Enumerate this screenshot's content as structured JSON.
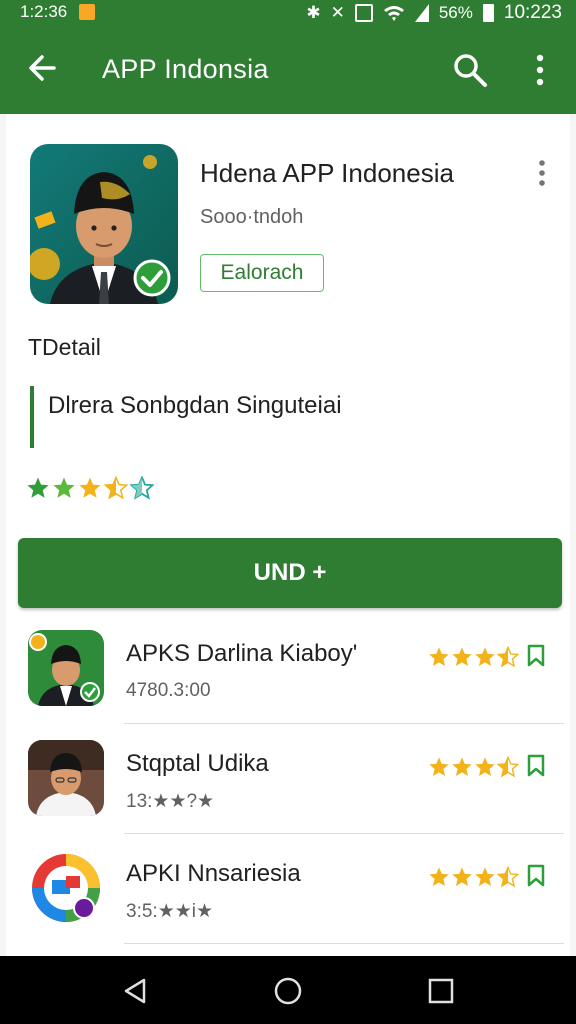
{
  "status_bar": {
    "time_left": "1:2:36",
    "battery_percent": "56%",
    "time_right": "10:223"
  },
  "app_bar": {
    "title": "APP Indonsia",
    "icons": [
      "back-arrow-icon",
      "search-icon",
      "more-vert-icon"
    ]
  },
  "app": {
    "name": "Hdena APP Indonesia",
    "developer": "Sooo·tndoh",
    "badge": "Ealorach",
    "icon": "official-portrait-icon"
  },
  "detail": {
    "heading": "TDetail",
    "description": "Dlrera Sonbgdan Singuteiai",
    "rating_stars": 3.5
  },
  "install_button": {
    "label": "UND +"
  },
  "list": [
    {
      "name": "APKS Darlina Kiaboy'",
      "sub": "4780.3:00",
      "stars": 3.5,
      "icon": "portrait-green-icon"
    },
    {
      "name": "Stqptal Udika",
      "sub": "13:★★?★",
      "stars": 3.5,
      "icon": "portrait-white-icon"
    },
    {
      "name": "APKI Nnsariesia",
      "sub": "3:5:★★i★",
      "stars": 3.5,
      "icon": "colorful-app-icon"
    }
  ],
  "colors": {
    "primary": "#2e7d32",
    "star_gold": "#f2b21a",
    "star_green": "#2e9e3a"
  }
}
